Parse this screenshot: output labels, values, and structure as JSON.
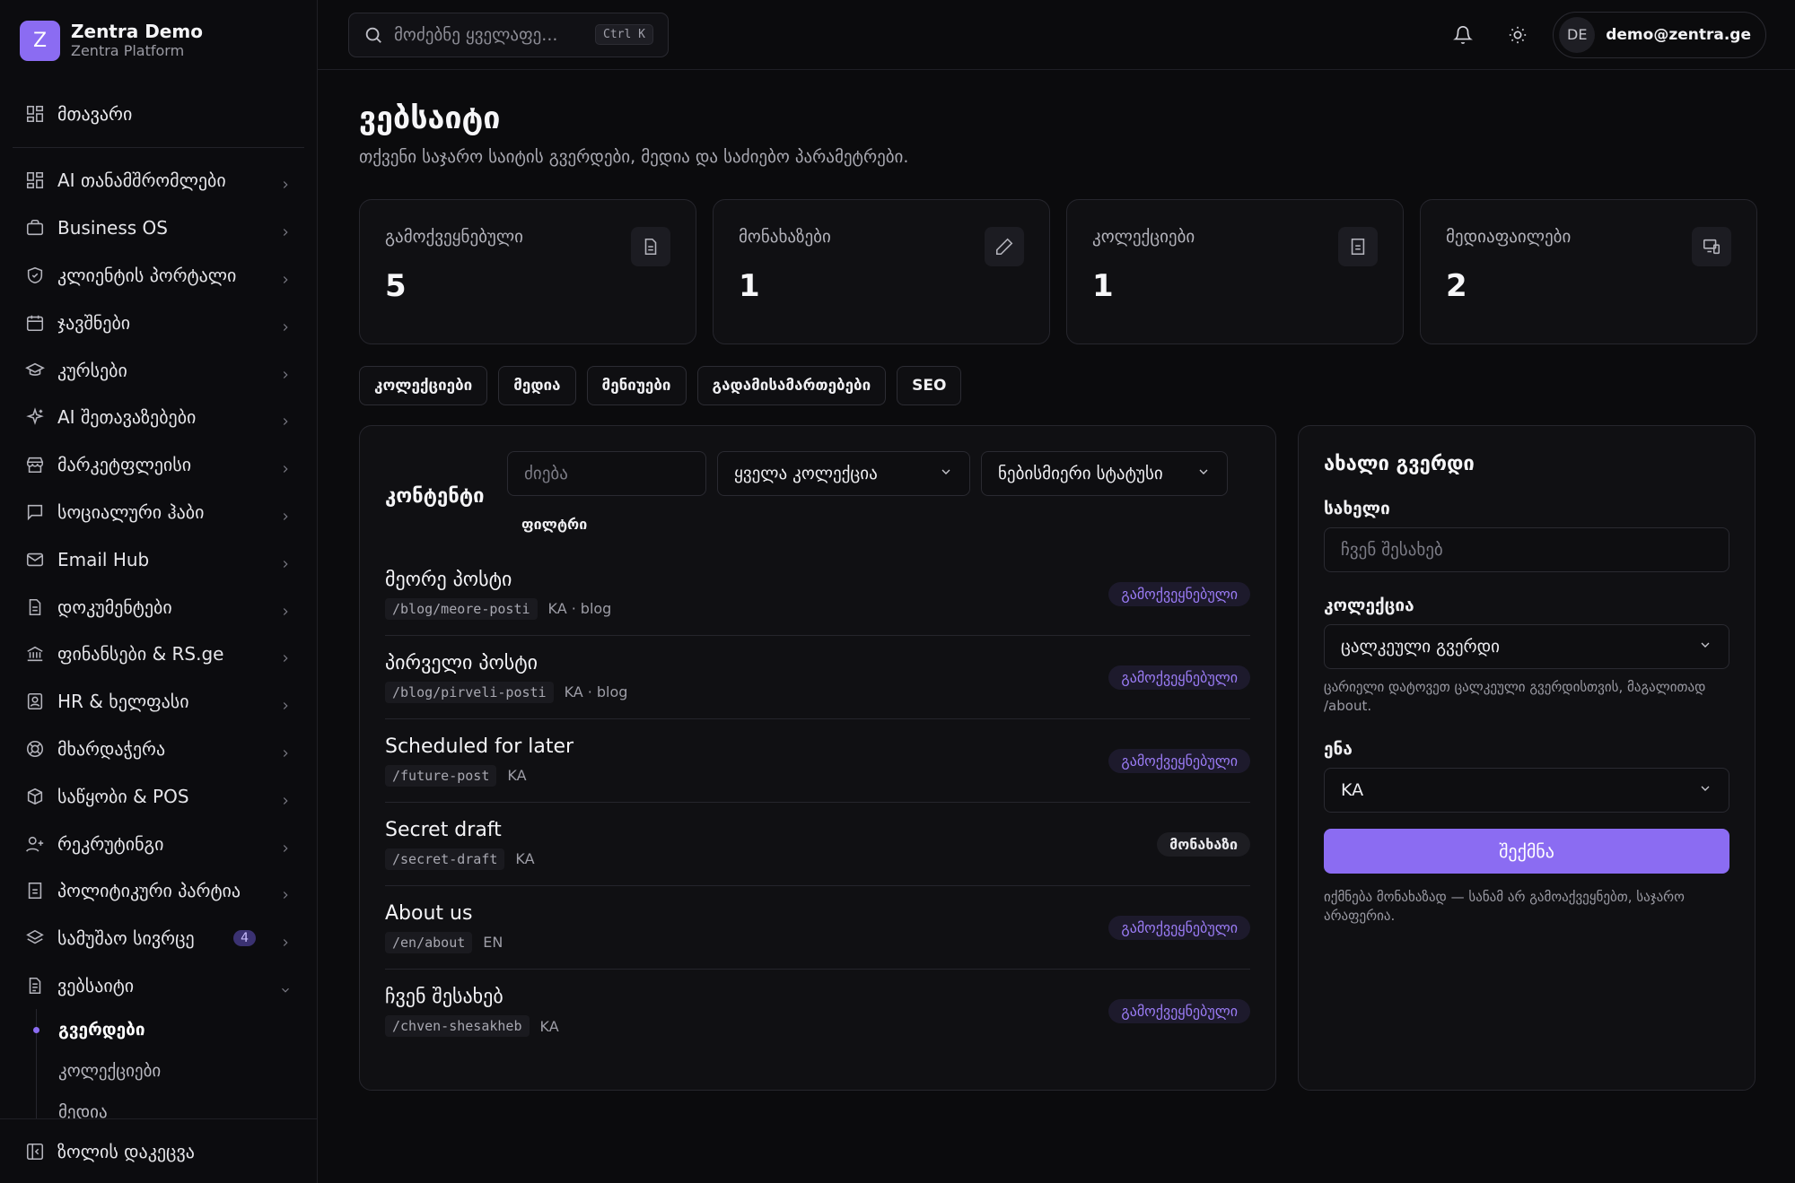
{
  "brand": {
    "logo_letter": "Z",
    "name": "Zentra Demo",
    "subtitle": "Zentra Platform",
    "accent": "#8b6cf2"
  },
  "sidebar": {
    "home": "მთავარი",
    "items": [
      {
        "label": "AI თანამშრომლები",
        "icon": "grid-icon"
      },
      {
        "label": "Business OS",
        "icon": "briefcase-icon"
      },
      {
        "label": "კლიენტის პორტალი",
        "icon": "shield-icon"
      },
      {
        "label": "ჯავშნები",
        "icon": "calendar-icon"
      },
      {
        "label": "კურსები",
        "icon": "graduation-cap-icon"
      },
      {
        "label": "AI შეთავაზებები",
        "icon": "sparkles-icon"
      },
      {
        "label": "მარკეტფლეისი",
        "icon": "store-icon"
      },
      {
        "label": "სოციალური ჰაბი",
        "icon": "message-square-icon"
      },
      {
        "label": "Email Hub",
        "icon": "mail-icon"
      },
      {
        "label": "დოკუმენტები",
        "icon": "file-icon"
      },
      {
        "label": "ფინანსები & RS.ge",
        "icon": "bank-icon"
      },
      {
        "label": "HR & ხელფასი",
        "icon": "id-badge-icon"
      },
      {
        "label": "მხარდაჭერა",
        "icon": "lifebuoy-icon"
      },
      {
        "label": "საწყობი & POS",
        "icon": "package-icon"
      },
      {
        "label": "რეკრუტინგი",
        "icon": "user-plus-icon"
      },
      {
        "label": "პოლიტიკური პარტია",
        "icon": "building-icon"
      },
      {
        "label": "სამუშაო სივრცე",
        "icon": "layers-icon",
        "badge": "4"
      },
      {
        "label": "ვებსაიტი",
        "icon": "file-text-icon"
      }
    ],
    "subitems": [
      {
        "label": "გვერდები",
        "active": true
      },
      {
        "label": "კოლექციები",
        "active": false
      },
      {
        "label": "მედია",
        "active": false
      }
    ],
    "footer": "ზოლის დაკეცვა"
  },
  "topbar": {
    "search_placeholder": "მოძებნე ყველაფე...",
    "shortcut": "Ctrl K",
    "user_initials": "DE",
    "user_email": "demo@zentra.ge"
  },
  "page": {
    "title": "ვებსაიტი",
    "subtitle": "თქვენი საჯარო საიტის გვერდები, მედია და საძიებო პარამეტრები."
  },
  "stats": [
    {
      "label": "გამოქვეყნებული",
      "value": "5",
      "icon": "file-icon"
    },
    {
      "label": "მონახაზები",
      "value": "1",
      "icon": "pencil-icon"
    },
    {
      "label": "კოლექციები",
      "value": "1",
      "icon": "building-icon"
    },
    {
      "label": "მედიაფაილები",
      "value": "2",
      "icon": "devices-icon"
    }
  ],
  "tabs": [
    "კოლექციები",
    "მედია",
    "მენიუები",
    "გადამისამართებები",
    "SEO"
  ],
  "content_panel": {
    "title": "კონტენტი",
    "search_placeholder": "ძიება",
    "collection_filter": "ყველა კოლექცია",
    "status_filter": "ნებისმიერი სტატუსი",
    "filter_button": "ფილტრი",
    "rows": [
      {
        "title": "მეორე პოსტი",
        "slug": "/blog/meore-posti",
        "lang": "KA",
        "collection": "blog",
        "status": "გამოქვეყნებული",
        "status_kind": "published"
      },
      {
        "title": "პირველი პოსტი",
        "slug": "/blog/pirveli-posti",
        "lang": "KA",
        "collection": "blog",
        "status": "გამოქვეყნებული",
        "status_kind": "published"
      },
      {
        "title": "Scheduled for later",
        "slug": "/future-post",
        "lang": "KA",
        "collection": "",
        "status": "გამოქვეყნებული",
        "status_kind": "published"
      },
      {
        "title": "Secret draft",
        "slug": "/secret-draft",
        "lang": "KA",
        "collection": "",
        "status": "მონახაზი",
        "status_kind": "draft"
      },
      {
        "title": "About us",
        "slug": "/en/about",
        "lang": "EN",
        "collection": "",
        "status": "გამოქვეყნებული",
        "status_kind": "published"
      },
      {
        "title": "ჩვენ შესახებ",
        "slug": "/chven-shesakheb",
        "lang": "KA",
        "collection": "",
        "status": "გამოქვეყნებული",
        "status_kind": "published"
      }
    ]
  },
  "new_page": {
    "title": "ახალი გვერდი",
    "name_label": "სახელი",
    "name_placeholder": "ჩვენ შესახებ",
    "collection_label": "კოლექცია",
    "collection_value": "ცალკეული გვერდი",
    "collection_help": "ცარიელი დატოვეთ ცალკეული გვერდისთვის, მაგალითად /about.",
    "language_label": "ენა",
    "language_value": "KA",
    "submit_label": "შექმნა",
    "footnote": "იქმნება მონახაზად — სანამ არ გამოაქვეყნებთ, საჯარო არაფერია."
  }
}
